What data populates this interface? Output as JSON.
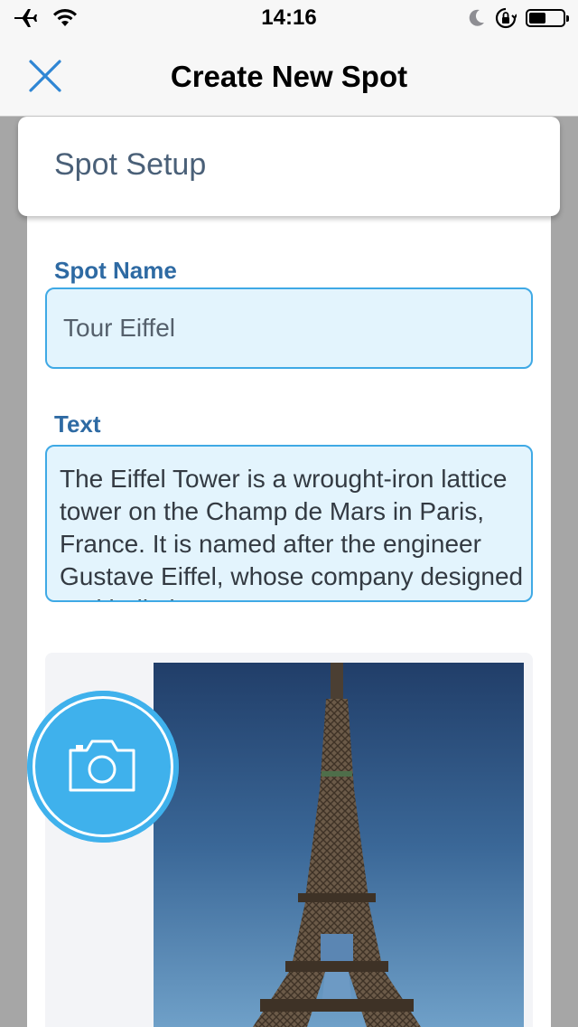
{
  "status_bar": {
    "time": "14:16",
    "left_icons": [
      "airplane-icon",
      "wifi-icon"
    ],
    "right_icons": [
      "moon-icon",
      "orientation-lock-icon",
      "battery-icon"
    ],
    "battery_level": 0.5
  },
  "nav": {
    "title": "Create New Spot",
    "close_icon": "close-icon",
    "accent_color": "#2f86d4"
  },
  "setup_card": {
    "title": "Spot Setup"
  },
  "form": {
    "name_label": "Spot Name",
    "name_value": "Tour Eiffel",
    "text_label": "Text",
    "text_value": "The Eiffel Tower is a wrought-iron lattice tower on the Champ de Mars in Paris, France. It is named after the engineer Gustave Eiffel, whose company designed and built the tower."
  },
  "media": {
    "camera_button_icon": "camera-icon",
    "camera_button_color": "#3fb1ec",
    "photo_subject": "eiffel-tower-photo"
  }
}
